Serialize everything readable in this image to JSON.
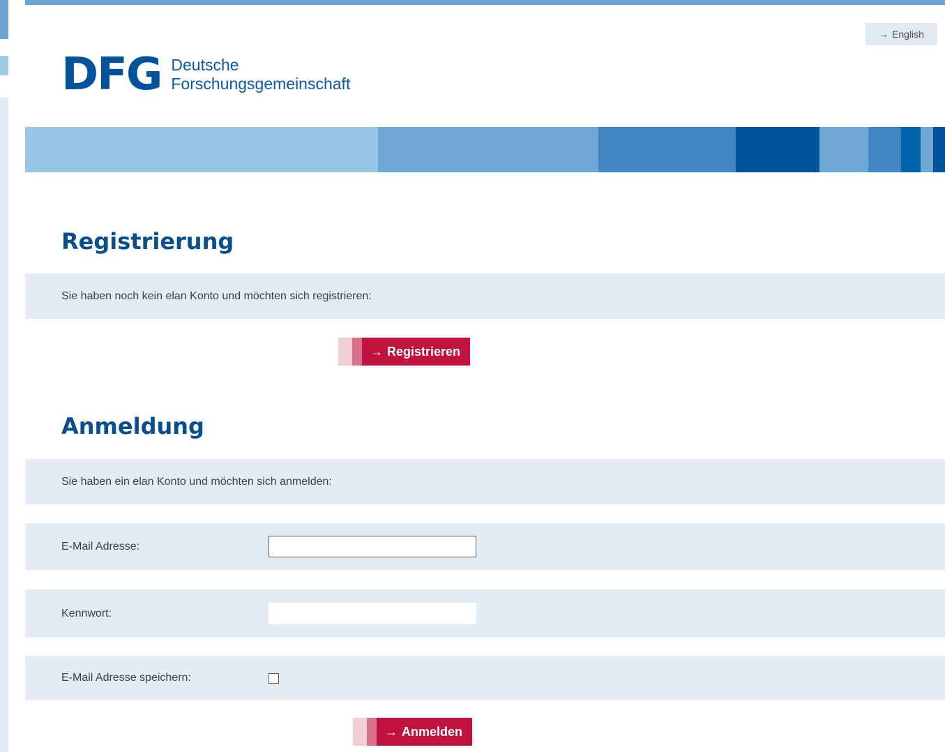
{
  "header": {
    "language_link": "English",
    "logo_mark": "DFG",
    "logo_line1": "Deutsche",
    "logo_line2": "Forschungsgemeinschaft",
    "colors": {
      "brand_blue": "#00529c",
      "band": [
        "#98c6e7",
        "#6fa7d4",
        "#3f86c2",
        "#00529c",
        "#6fa7d4",
        "#3f86c2",
        "#0063ad",
        "#6fa7d4",
        "#00529c"
      ]
    }
  },
  "registration": {
    "title": "Registrierung",
    "prompt": "Sie haben noch kein elan Konto und möchten sich registrieren:",
    "button_label": "Registrieren"
  },
  "login": {
    "title": "Anmeldung",
    "prompt": "Sie haben ein elan Konto und möchten sich anmelden:",
    "email_label": "E-Mail Adresse:",
    "email_value": "",
    "password_label": "Kennwort:",
    "password_value": "",
    "remember_label": "E-Mail Adresse speichern:",
    "remember_checked": false,
    "button_label": "Anmelden"
  },
  "accent_color": "#c0123f"
}
